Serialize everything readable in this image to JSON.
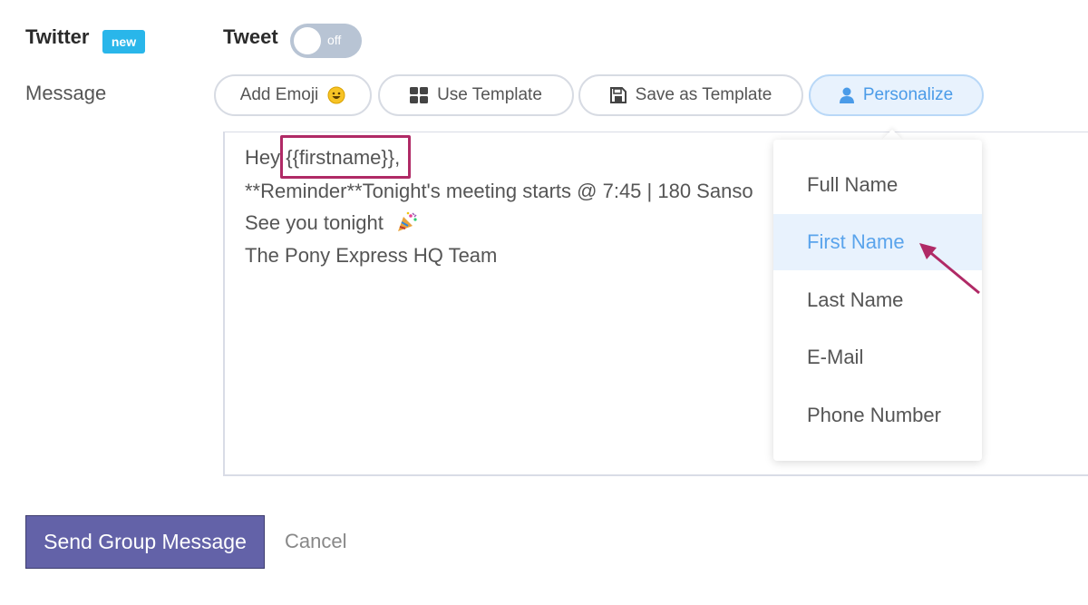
{
  "twitter": {
    "label": "Twitter",
    "badge": "new",
    "tweet_label": "Tweet",
    "toggle_state": "off"
  },
  "message": {
    "label": "Message",
    "toolbar": {
      "add_emoji": "Add Emoji",
      "use_template": "Use Template",
      "save_template": "Save as Template",
      "personalize": "Personalize"
    },
    "lines": [
      "Hey {{firstname}},",
      "**Reminder**Tonight's meeting starts @ 7:45 | 180 Sanso",
      "See you tonight",
      "The Pony Express HQ Team"
    ]
  },
  "personalize_menu": {
    "items": [
      "Full Name",
      "First Name",
      "Last Name",
      "E-Mail",
      "Phone Number"
    ],
    "selected": "First Name"
  },
  "actions": {
    "send": "Send Group Message",
    "cancel": "Cancel"
  },
  "colors": {
    "accent_blue": "#29b6ea",
    "personalize_blue": "#4a9be8",
    "send_purple": "#6362a8",
    "highlight": "#b02a66"
  }
}
